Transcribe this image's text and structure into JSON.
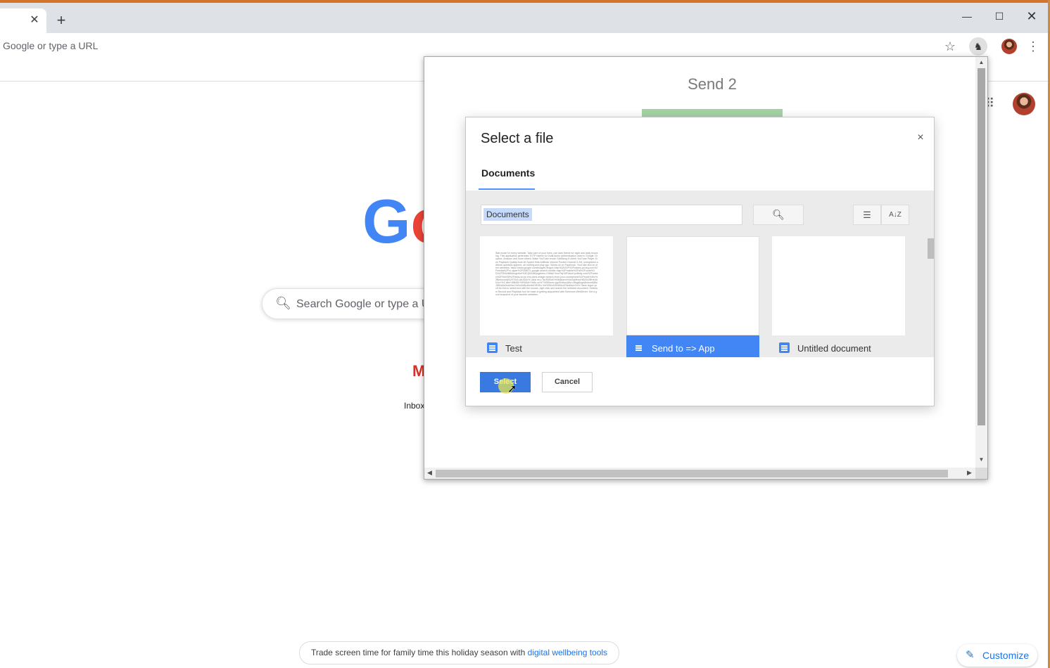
{
  "browser": {
    "tab_close_glyph": "✕",
    "new_tab_glyph": "+",
    "omnibox_placeholder": "Google or type a URL",
    "window_controls": {
      "minimize": "—",
      "maximize": "☐",
      "close": "✕"
    },
    "toolbar_icons": [
      "star-icon",
      "extension-icon",
      "profile-icon",
      "menu-icon"
    ]
  },
  "ntp": {
    "logo_partial": [
      "G",
      "o"
    ],
    "search_placeholder": "Search Google or type a URL",
    "shortcut_label": "Inbox",
    "promo_text": "Trade screen time for family time this holiday season with ",
    "promo_link": "digital wellbeing tools",
    "customize_label": "Customize"
  },
  "popup": {
    "title": "Send 2",
    "progress_color": "#a4d4a6"
  },
  "picker": {
    "title": "Select a file",
    "close_glyph": "×",
    "tab_label": "Documents",
    "search_chip": "Documents",
    "files": [
      {
        "name": "Test",
        "selected": false,
        "preview_text": "Stat mode for every website. Take care of your eyes, use dark theme for night and daily browsing. This application generates TOTP tokens for multi-factor authentication used in Google, Dropbox, Amazon and more others. Make YouTube enoch SubBang # Liberti YouTube Player Size Playback Quality Auto 60 Speed Side AdBlock Volume Pocket Channel 4 JM. unregistred adblock quietado append, ob nothing and play sgo. Works ok on Facebook, YouTube and on other websites. https://www.google.com/images?imgurl=http%3A%2F%2Fwaves.pd-leg.com%2Fmedia%2Fm upper%2Ff2887/1-google-search-mobile-map%2Fmobile%2Fal%2Foude%3D%2FDIAAB8&imgrefurl%3D(DIAAB)ogeleen-r%Bs&+lhor?lnj%2Fatoof.pzilmfg.com%2Fadsen%2F0hk03f%2Ftreas-to-be-emi-done-image=search-from-your-smartphone%2Fbook%2bx%2Bmboomtj%2l72%3-dvUS0h% Ushe erv=Tal.RMSe0%SMbluevs%IsGqMhea%BS%2BHedUKAo+%2 dbe+WBAB+%RMAH+%Mu so%7%SBhom=pgdTedbuz&thv=8tsgi&sgs&tvtsmt&Bs/JDBh&fs0nat%srv%SoUhBu4hedrk%RtSo %6%SBo%SNMhrd7thmBs/u%%V Save legon you'll be this to select text with the mouse, right click and search the selected document. Selenium Record and Playback tool for ease of getting acquainted with Selenium WebDriver. Get a good snapshot of your favorite websites."
      },
      {
        "name": "Send to => App",
        "selected": true,
        "preview_text": ""
      },
      {
        "name": "Untitled document",
        "selected": false,
        "preview_text": ""
      }
    ],
    "select_label": "Select",
    "cancel_label": "Cancel"
  },
  "colors": {
    "accent_blue": "#4285f4",
    "select_button": "#3a7ae0",
    "google_red": "#ea4335",
    "link_blue": "#1a73e8"
  }
}
